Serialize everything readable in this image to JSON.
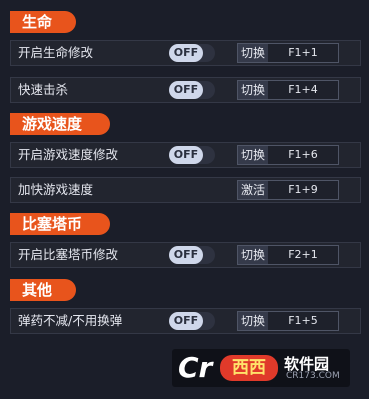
{
  "sections": [
    {
      "title": "生命",
      "rows": [
        {
          "label": "开启生命修改",
          "toggle": "OFF",
          "action": "切换",
          "hotkey": "F1+1"
        },
        {
          "label": "快速击杀",
          "toggle": "OFF",
          "action": "切换",
          "hotkey": "F1+4"
        }
      ]
    },
    {
      "title": "游戏速度",
      "rows": [
        {
          "label": "开启游戏速度修改",
          "toggle": "OFF",
          "action": "切换",
          "hotkey": "F1+6"
        },
        {
          "label": "加快游戏速度",
          "action": "激活",
          "hotkey": "F1+9"
        }
      ]
    },
    {
      "title": "比塞塔币",
      "rows": [
        {
          "label": "开启比塞塔币修改",
          "toggle": "OFF",
          "action": "切换",
          "hotkey": "F2+1"
        }
      ]
    },
    {
      "title": "其他",
      "rows": [
        {
          "label": "弹药不减/不用换弹",
          "toggle": "OFF",
          "action": "切换",
          "hotkey": "F1+5"
        }
      ]
    }
  ],
  "watermark": {
    "logo": "Cr",
    "brand": "西西",
    "text": "软件园",
    "sub": "CR173.COM"
  },
  "colors": {
    "accent": "#e8541c",
    "background": "#1b1e29",
    "toggle_knob": "#cfd7ea"
  }
}
